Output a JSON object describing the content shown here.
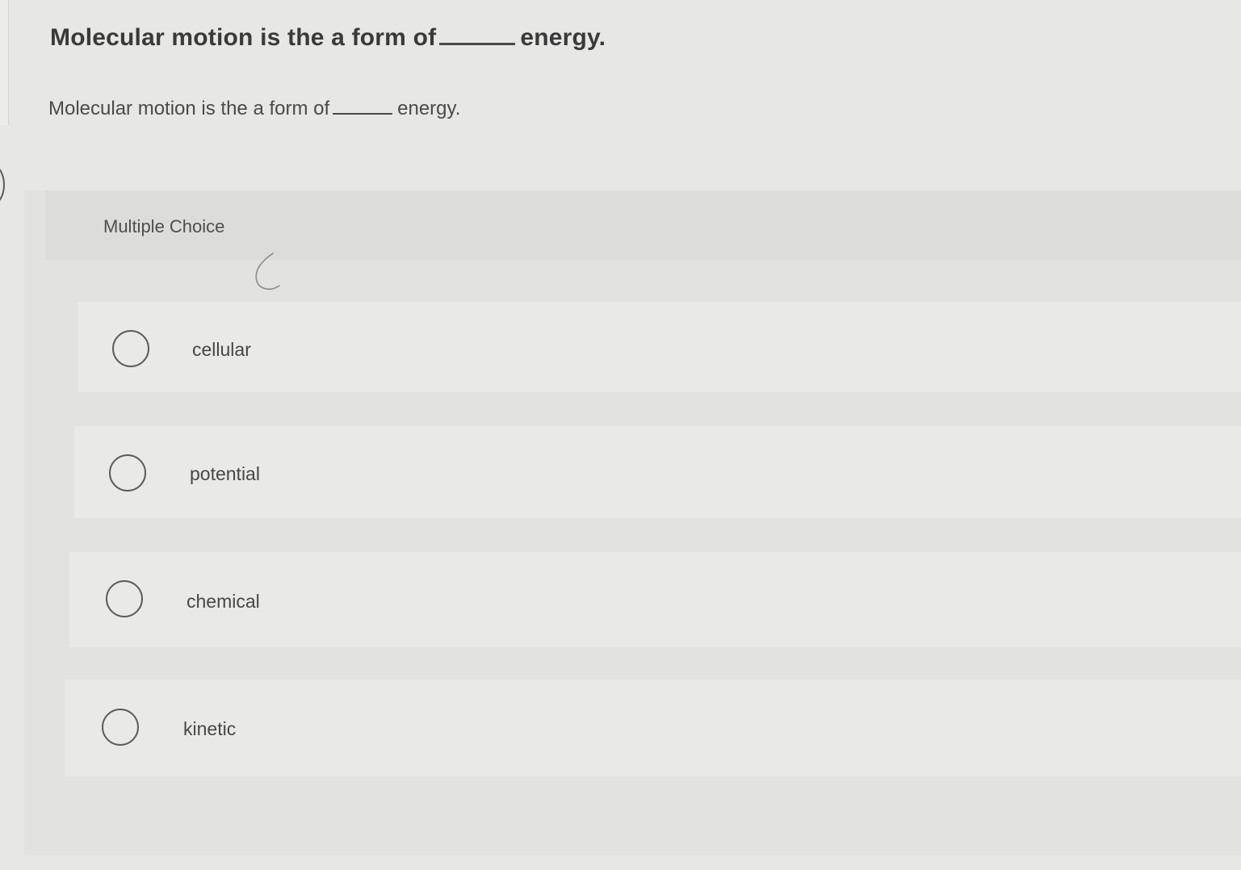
{
  "question": {
    "title_before": "Molecular motion is the a form of",
    "title_after": "energy.",
    "prompt_before": "Molecular motion is the a form of",
    "prompt_after": "energy."
  },
  "answer_section": {
    "label": "Multiple Choice",
    "options": [
      {
        "label": "cellular",
        "selected": false
      },
      {
        "label": "potential",
        "selected": false
      },
      {
        "label": "chemical",
        "selected": false
      },
      {
        "label": "kinetic",
        "selected": false
      }
    ]
  }
}
